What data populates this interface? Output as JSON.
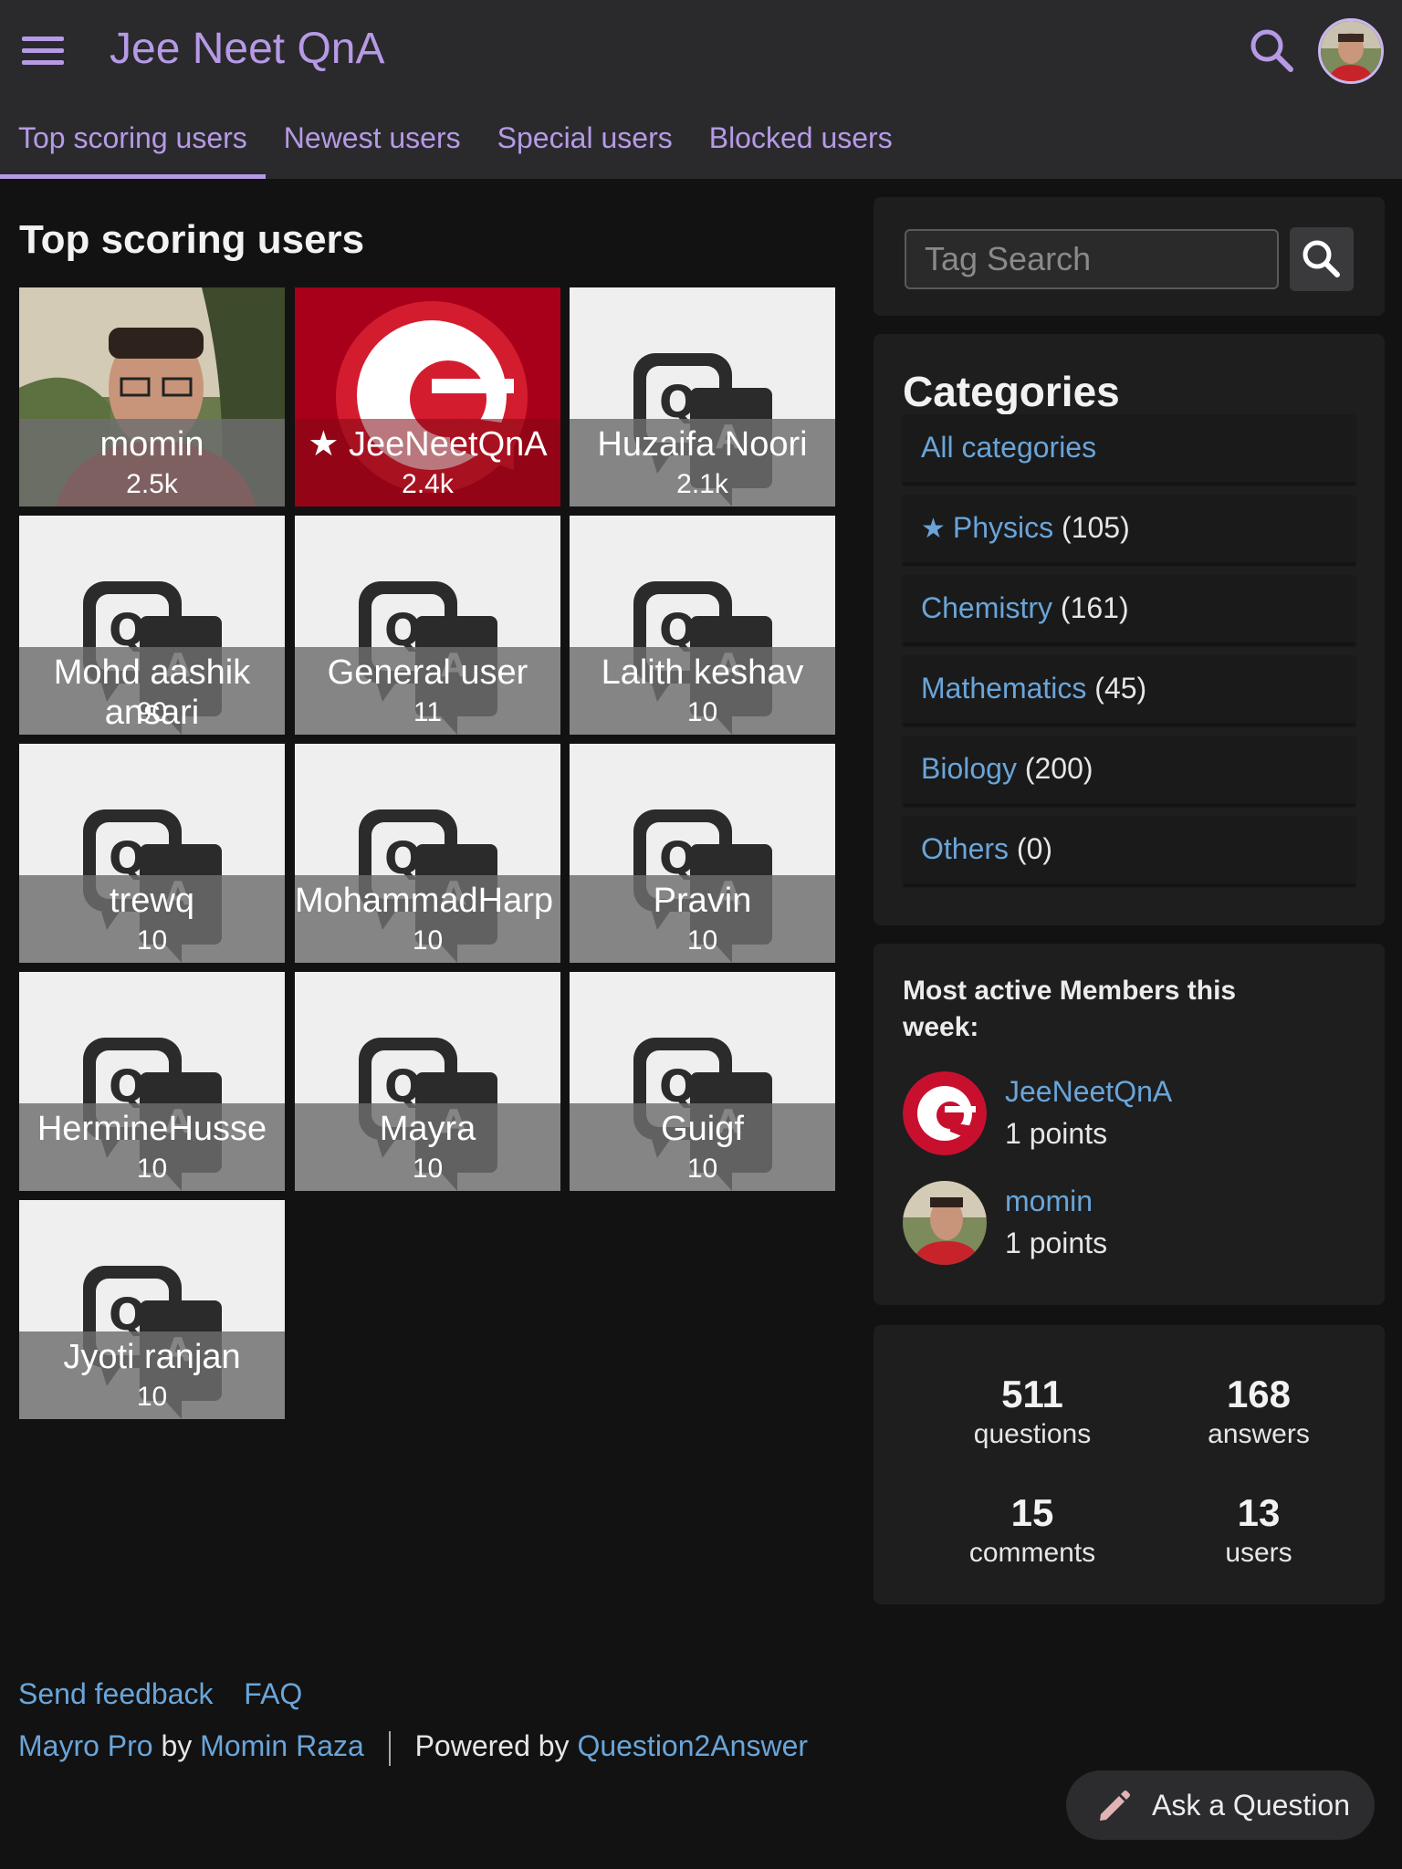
{
  "header": {
    "site_title": "Jee Neet QnA",
    "menu_icon": "hamburger-menu-icon",
    "search_icon": "search-icon",
    "accent_color": "#b69ae6"
  },
  "tabs": [
    {
      "label": "Top scoring users",
      "active": true
    },
    {
      "label": "Newest users",
      "active": false
    },
    {
      "label": "Special users",
      "active": false
    },
    {
      "label": "Blocked users",
      "active": false
    }
  ],
  "main": {
    "heading": "Top scoring users",
    "users": [
      {
        "name": "momin",
        "score": "2.5k",
        "avatar": "photo"
      },
      {
        "name": "JeeNeetQnA",
        "score": "2.4k",
        "avatar": "brand-logo",
        "special": true
      },
      {
        "name": "Huzaifa Noori",
        "score": "2.1k",
        "avatar": "default-qa"
      },
      {
        "name": "Mohd aashik ansari",
        "score": "90",
        "avatar": "default-qa"
      },
      {
        "name": "General user",
        "score": "11",
        "avatar": "default-qa"
      },
      {
        "name": "Lalith keshav",
        "score": "10",
        "avatar": "default-qa"
      },
      {
        "name": "trewq",
        "score": "10",
        "avatar": "default-qa"
      },
      {
        "name": "MohammadHarp",
        "score": "10",
        "avatar": "default-qa"
      },
      {
        "name": "Pravin",
        "score": "10",
        "avatar": "default-qa"
      },
      {
        "name": "HermineHusse",
        "score": "10",
        "avatar": "default-qa"
      },
      {
        "name": "Mayra",
        "score": "10",
        "avatar": "default-qa"
      },
      {
        "name": "Guigf",
        "score": "10",
        "avatar": "default-qa"
      },
      {
        "name": "Jyoti ranjan",
        "score": "10",
        "avatar": "default-qa"
      }
    ]
  },
  "sidebar": {
    "tag_search": {
      "placeholder": "Tag Search"
    },
    "categories": {
      "heading": "Categories",
      "items": [
        {
          "label": "All categories",
          "count": ""
        },
        {
          "label": "Physics",
          "count": "(105)",
          "starred": true
        },
        {
          "label": "Chemistry",
          "count": "(161)"
        },
        {
          "label": "Mathematics",
          "count": "(45)"
        },
        {
          "label": "Biology",
          "count": "(200)"
        },
        {
          "label": "Others",
          "count": "(0)"
        }
      ]
    },
    "active_members": {
      "heading": "Most active Members this week:",
      "members": [
        {
          "name": "JeeNeetQnA",
          "points": "1 points"
        },
        {
          "name": "momin",
          "points": "1 points"
        }
      ]
    },
    "stats": [
      {
        "num": "511",
        "label": "questions"
      },
      {
        "num": "168",
        "label": "answers"
      },
      {
        "num": "15",
        "label": "comments"
      },
      {
        "num": "13",
        "label": "users"
      }
    ]
  },
  "footer": {
    "send_feedback": "Send feedback",
    "faq": "FAQ",
    "theme": "Mayro Pro",
    "by": "by",
    "author": "Momin Raza",
    "powered_by": "Powered by",
    "engine": "Question2Answer"
  },
  "ask_button": {
    "label": "Ask a Question",
    "icon": "pencil-icon"
  }
}
